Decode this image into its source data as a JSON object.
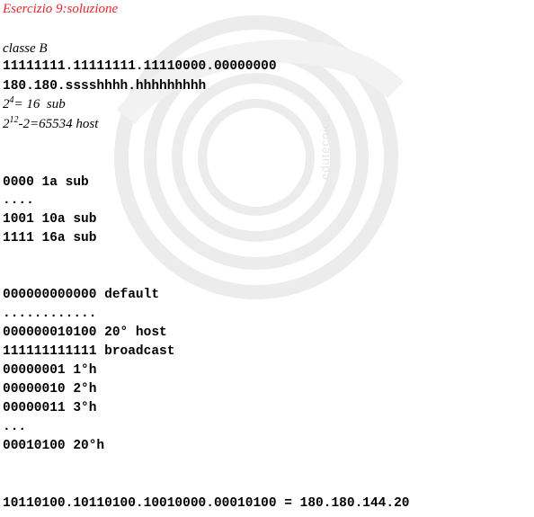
{
  "title": "Esercizio 9:soluzione",
  "watermark": "edutecnica",
  "class_label": "classe B",
  "mask_bits": "11111111.11111111.11110000.00000000",
  "address_pattern": "180.180.sssshhhh.hhhhhhhhh",
  "subnets_line": {
    "base": "2",
    "exp": "4",
    "rest": "= 16  sub"
  },
  "hosts_line": {
    "base": "2",
    "exp": "12",
    "rest": "-2=65534 host"
  },
  "subnet_list": [
    "0000 1a sub",
    "....",
    "1001 10a sub",
    "1111 16a sub"
  ],
  "host_list": [
    "000000000000 default",
    "............",
    "000000010100 20° host",
    "111111111111 broadcast",
    "00000001 1°h",
    "00000010 2°h",
    "00000011 3°h",
    "...",
    "00010100 20°h"
  ],
  "result_line": "10110100.10110100.10010000.00010100 = 180.180.144.20"
}
